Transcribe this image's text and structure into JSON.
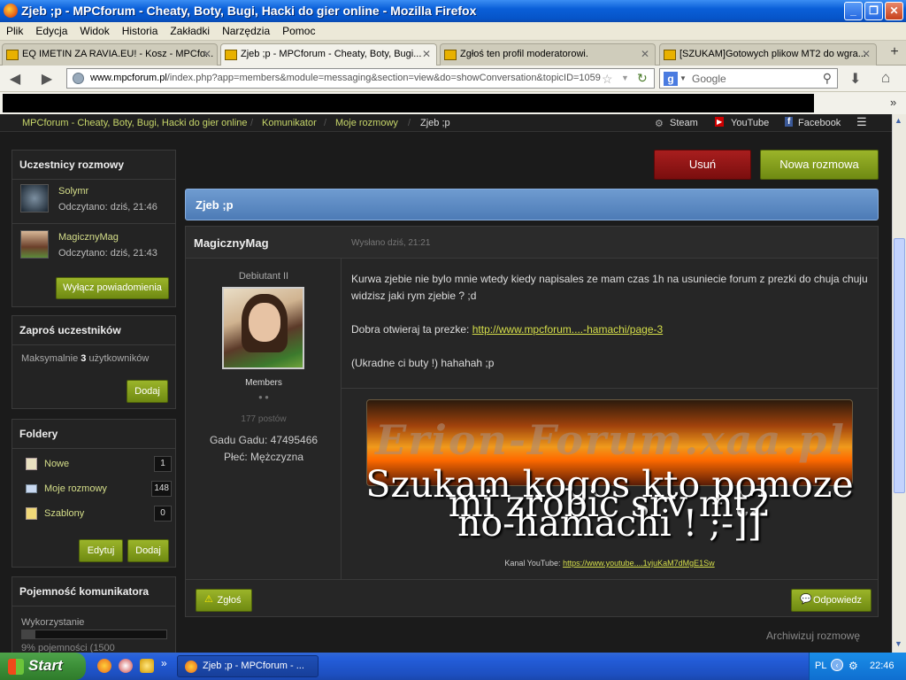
{
  "window": {
    "title": "Zjeb ;p - MPCforum - Cheaty, Boty, Bugi, Hacki do gier online - Mozilla Firefox",
    "buttons": {
      "minimize": "_",
      "maximize": "❐",
      "close": "✕"
    }
  },
  "menu": [
    "Plik",
    "Edycja",
    "Widok",
    "Historia",
    "Zakładki",
    "Narzędzia",
    "Pomoc"
  ],
  "tabs": [
    {
      "label": "EQ IMETIN ZA RAVIA.EU! - Kosz - MPCfo...",
      "active": false
    },
    {
      "label": "Zjeb ;p - MPCforum - Cheaty, Boty, Bugi...",
      "active": true
    },
    {
      "label": "Zgłoś ten profil moderatorowi.",
      "active": false
    },
    {
      "label": "[SZUKAM]Gotowych plikow MT2 do wgra...",
      "active": false
    }
  ],
  "nav": {
    "url_domain": "www.mpcforum.pl",
    "url_path": "/index.php?app=members&module=messaging&section=view&do=showConversation&topicID=1059",
    "search_placeholder": "Google",
    "more_bookmarks": "»"
  },
  "breadcrumbs": [
    "MPCforum - Cheaty, Boty, Bugi, Hacki do gier online",
    "Komunikator",
    "Moje rozmowy",
    "Zjeb ;p"
  ],
  "social": [
    "Steam",
    "YouTube",
    "Facebook"
  ],
  "sidebar": {
    "participants": {
      "title": "Uczestnicy rozmowy",
      "users": [
        {
          "name": "Solymr",
          "read": "Odczytano: dziś, 21:46"
        },
        {
          "name": "MagicznyMag",
          "read": "Odczytano: dziś, 21:43"
        }
      ],
      "button": "Wyłącz powiadomienia"
    },
    "invite": {
      "title": "Zaproś uczestników",
      "text_pre": "Maksymalnie",
      "text_num": "3",
      "text_post": "użytkowników",
      "button": "Dodaj"
    },
    "folders": {
      "title": "Foldery",
      "items": [
        {
          "label": "Nowe",
          "count": "1"
        },
        {
          "label": "Moje rozmowy",
          "count": "148"
        },
        {
          "label": "Szablony",
          "count": "0"
        }
      ],
      "edit": "Edytuj",
      "add": "Dodaj"
    },
    "capacity": {
      "title": "Pojemność komunikatora",
      "label": "Wykorzystanie",
      "usage": 0.09,
      "text": "9% pojemności (1500"
    }
  },
  "actions": {
    "delete": "Usuń",
    "new_conversation": "Nowa rozmowa"
  },
  "conversation": {
    "title": "Zjeb ;p",
    "author": "MagicznyMag",
    "sent": "Wysłano dziś, 21:21",
    "rank": "Debiutant II",
    "group": "Members",
    "posts": "177 postów",
    "gadu": "Gadu Gadu: 47495466",
    "gender": "Płeć: Mężczyzna",
    "body": {
      "line1": "Kurwa zjebie nie bylo mnie wtedy kiedy napisales ze mam czas 1h na usuniecie forum z prezki do chuja chuju widzisz jaki rym zjebie ? ;d",
      "line2_pre": "Dobra otwieraj ta prezke:",
      "line2_link": "http://www.mpcforum....-hamachi/page-3",
      "line3": "(Ukradne ci buty !) hahahah ;p"
    },
    "signature": {
      "banner": "Erion-Forum.xaa.pl",
      "big_text_1": "Szukam kogos kto pomoze",
      "big_text_2": "mi zrobic srv mt2",
      "big_text_3": "no-hamachi ! ;-]]",
      "yt_label": "Kanal YouTube:",
      "yt_link": "https://www.youtube....1vjuKaM7dMgE1Sw"
    },
    "report": "Zgłoś",
    "reply": "Odpowiedz",
    "archive": "Archiwizuj rozmowę"
  },
  "taskbar": {
    "start": "Start",
    "task": "Zjeb ;p - MPCforum - ...",
    "lang": "PL",
    "time": "22:46",
    "quick_more": "»"
  },
  "colors": {
    "accent": "#7f9a1c",
    "danger": "#8a1414",
    "header_blue": "#5d8bc4"
  }
}
